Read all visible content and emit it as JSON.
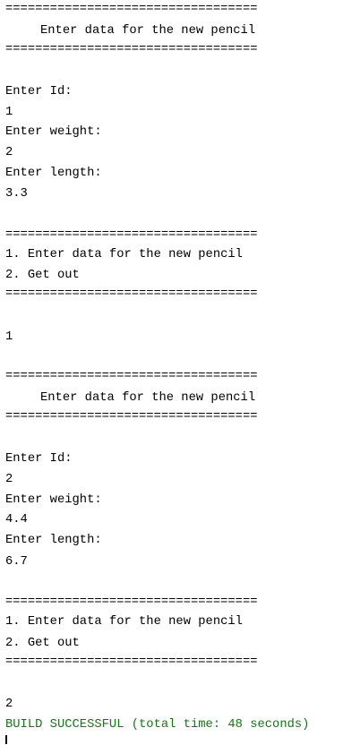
{
  "console": {
    "lines": {
      "separator": "==================================",
      "menu_title": "Enter data for the new pencil",
      "prompt_id": "Enter Id:",
      "prompt_weight": "Enter weight:",
      "prompt_length": "Enter length:",
      "menu_option_1": "1. Enter data for the new pencil",
      "menu_option_2": "2. Get out",
      "build_status": "BUILD SUCCESSFUL (total time: 48 seconds)"
    },
    "inputs": {
      "first": {
        "id": "1",
        "weight": "2",
        "length": "3.3",
        "choice": "1"
      },
      "second": {
        "id": "2",
        "weight": "4.4",
        "length": "6.7",
        "choice": "2"
      }
    },
    "colors": {
      "text": "#000000",
      "success": "#117a11",
      "background": "#ffffff"
    }
  }
}
